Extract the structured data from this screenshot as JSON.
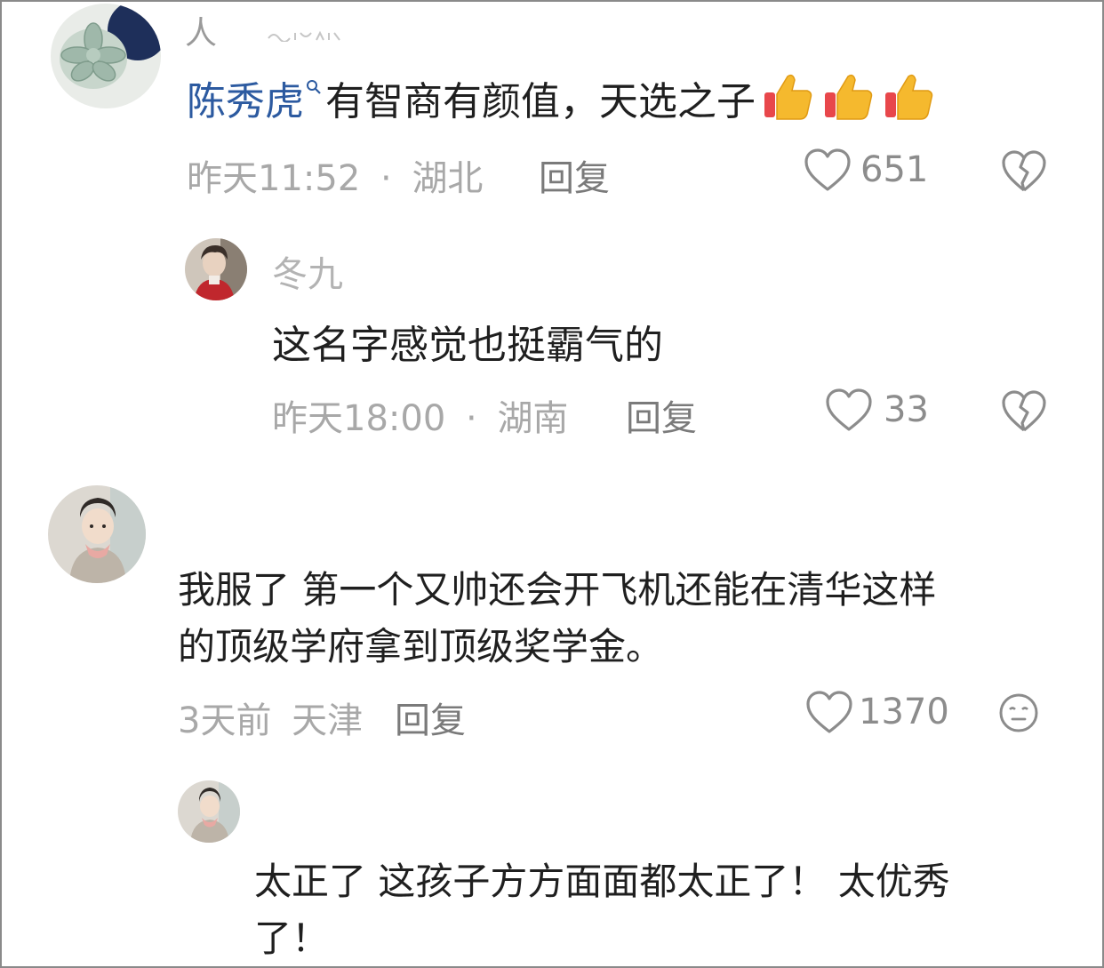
{
  "comments": [
    {
      "nickname": "人",
      "mention": "陈秀虎",
      "text": "有智商有颜值，天选之子",
      "emoji_icons": [
        "thumbs-up-icon",
        "thumbs-up-icon",
        "thumbs-up-icon"
      ],
      "time": "昨天11:52",
      "location": "湖北",
      "reply_label": "回复",
      "like_count": "651",
      "dislike_icon": "broken-heart-icon"
    },
    {
      "nickname": "冬九",
      "text": "这名字感觉也挺霸气的",
      "time": "昨天18:00",
      "location": "湖南",
      "reply_label": "回复",
      "like_count": "33",
      "dislike_icon": "broken-heart-icon"
    },
    {
      "text_line1": "我服了 第一个又帅还会开飞机还能在清华这样",
      "text_line2": "的顶级学府拿到顶级奖学金。",
      "time": "3天前",
      "location": "天津",
      "reply_label": "回复",
      "like_count": "1370",
      "reaction_icon": "meh-face-icon"
    },
    {
      "text_line1": "太正了 这孩子方方面面都太正了！ 太优秀",
      "text_line2": "了！"
    }
  ],
  "meta_separator": "·",
  "colors": {
    "mention": "#2c5aa0",
    "text": "#1f1f1f",
    "meta": "#a8a8a8",
    "thumb": "#f5b92e"
  }
}
